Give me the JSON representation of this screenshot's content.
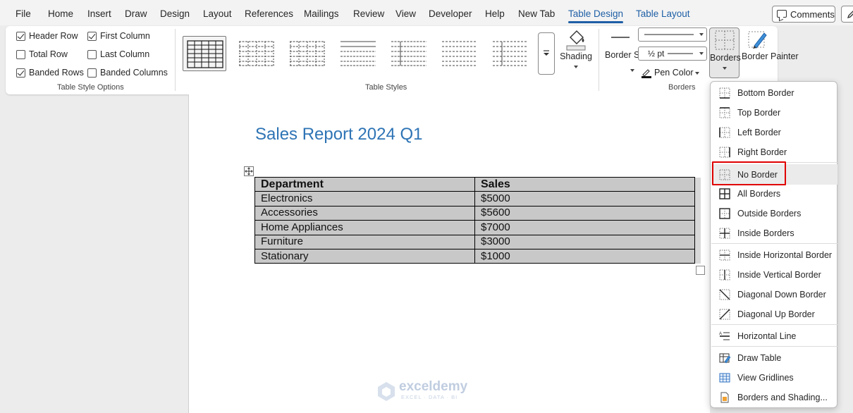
{
  "menu": {
    "tabs": [
      "File",
      "Home",
      "Insert",
      "Draw",
      "Design",
      "Layout",
      "References",
      "Mailings",
      "Review",
      "View",
      "Developer",
      "Help",
      "New Tab",
      "Table Design",
      "Table Layout"
    ],
    "active_tab": "Table Design",
    "comments_label": "Comments"
  },
  "ribbon": {
    "table_style_options": {
      "group_label": "Table Style Options",
      "options": [
        {
          "label": "Header Row",
          "checked": true
        },
        {
          "label": "First Column",
          "checked": true
        },
        {
          "label": "Total Row",
          "checked": false
        },
        {
          "label": "Last Column",
          "checked": false
        },
        {
          "label": "Banded Rows",
          "checked": true
        },
        {
          "label": "Banded Columns",
          "checked": false
        }
      ]
    },
    "table_styles": {
      "group_label": "Table Styles",
      "shading_label": "Shading"
    },
    "borders": {
      "group_label": "Borders",
      "border_styles_label": "Border Styles",
      "line_weight": "½ pt",
      "pen_color_label": "Pen Color",
      "borders_label": "Borders",
      "border_painter_label": "Border Painter"
    }
  },
  "document": {
    "title": "Sales Report 2024 Q1",
    "table": {
      "headers": [
        "Department",
        "Sales"
      ],
      "rows": [
        [
          "Electronics",
          "$5000"
        ],
        [
          "Accessories",
          "$5600"
        ],
        [
          "Home Appliances",
          "$7000"
        ],
        [
          "Furniture",
          "$3000"
        ],
        [
          "Stationary",
          "$1000"
        ]
      ]
    }
  },
  "borders_menu": {
    "items": [
      {
        "label": "Bottom Border",
        "icon": "bottom-border-icon"
      },
      {
        "label": "Top Border",
        "icon": "top-border-icon"
      },
      {
        "label": "Left Border",
        "icon": "left-border-icon"
      },
      {
        "label": "Right Border",
        "icon": "right-border-icon"
      },
      {
        "label": "No Border",
        "icon": "no-border-icon"
      },
      {
        "label": "All Borders",
        "icon": "all-borders-icon"
      },
      {
        "label": "Outside Borders",
        "icon": "outside-borders-icon"
      },
      {
        "label": "Inside Borders",
        "icon": "inside-borders-icon"
      },
      {
        "label": "Inside Horizontal Border",
        "icon": "inside-horizontal-border-icon"
      },
      {
        "label": "Inside Vertical Border",
        "icon": "inside-vertical-border-icon"
      },
      {
        "label": "Diagonal Down Border",
        "icon": "diagonal-down-border-icon"
      },
      {
        "label": "Diagonal Up Border",
        "icon": "diagonal-up-border-icon"
      },
      {
        "label": "Horizontal Line",
        "icon": "horizontal-line-icon"
      },
      {
        "label": "Draw Table",
        "icon": "draw-table-icon"
      },
      {
        "label": "View Gridlines",
        "icon": "view-gridlines-icon"
      },
      {
        "label": "Borders and Shading...",
        "icon": "borders-and-shading-icon"
      }
    ],
    "highlighted_item": "No Border",
    "highlight_color": "#e00000"
  },
  "watermark": {
    "name": "exceldemy",
    "tagline": "EXCEL · DATA · BI"
  },
  "colors": {
    "accent": "#1f5fa6",
    "title_blue": "#2e74b5",
    "table_fill": "#c8c8c8"
  }
}
